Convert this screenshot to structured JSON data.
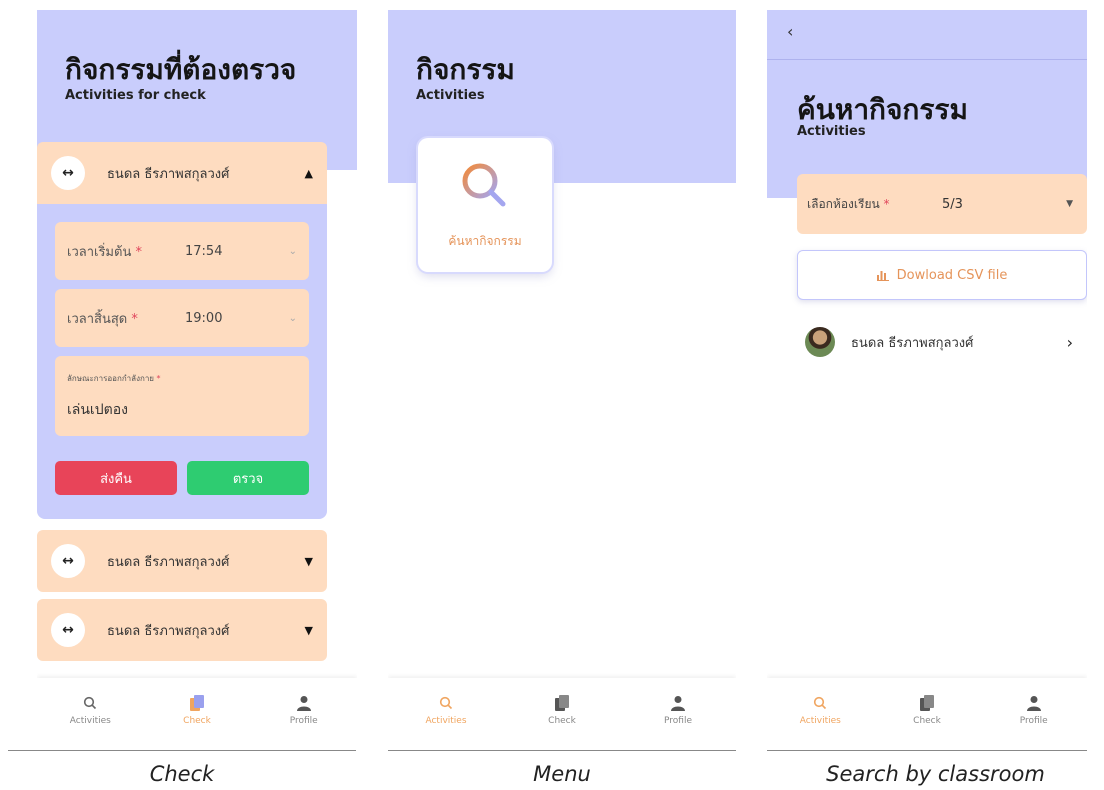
{
  "screens": {
    "check": {
      "title": "กิจกรรมที่ต้องตรวจ",
      "subtitle": "Activities for check",
      "expanded": {
        "name": "ธนดล ธีรภาพสกุลวงศ์",
        "start_label": "เวลาเริ่มต้น",
        "start_value": "17:54",
        "end_label": "เวลาสิ้นสุด",
        "end_value": "19:00",
        "type_label": "ลักษณะการออกกำลังกาย",
        "type_value": "เล่นเปตอง",
        "required_mark": "*",
        "return_label": "ส่งคืน",
        "check_label": "ตรวจ"
      },
      "collapsed": [
        {
          "name": "ธนดล ธีรภาพสกุลวงศ์"
        },
        {
          "name": "ธนดล ธีรภาพสกุลวงศ์"
        }
      ],
      "caption": "Check"
    },
    "menu": {
      "title": "กิจกรรม",
      "subtitle": "Activities",
      "card_label": "ค้นหากิจกรรม",
      "caption": "Menu"
    },
    "search": {
      "back": "‹",
      "title": "ค้นหากิจกรรม",
      "subtitle": "Activities",
      "classroom_label": "เลือกห้องเรียน",
      "required_mark": "*",
      "classroom_value": "5/3",
      "csv_label": "Dowload CSV file",
      "student_name": "ธนดล ธีรภาพสกุลวงศ์",
      "caption": "Search by classroom"
    }
  },
  "nav": {
    "activities": "Activities",
    "check": "Check",
    "profile": "Profile"
  },
  "colors": {
    "header_bg": "#c9cdfc",
    "card_bg": "#fedcc0",
    "accent_orange": "#f0a560",
    "return_button": "#e84459",
    "check_button": "#2ecc71",
    "required": "#e0455b"
  },
  "icons": [
    "dumbbell-icon",
    "caret-up-icon",
    "caret-down-icon",
    "chevron-down-icon",
    "search-icon",
    "document-icon",
    "user-icon",
    "back-icon",
    "bar-chart-icon",
    "chevron-right-icon",
    "avatar"
  ]
}
